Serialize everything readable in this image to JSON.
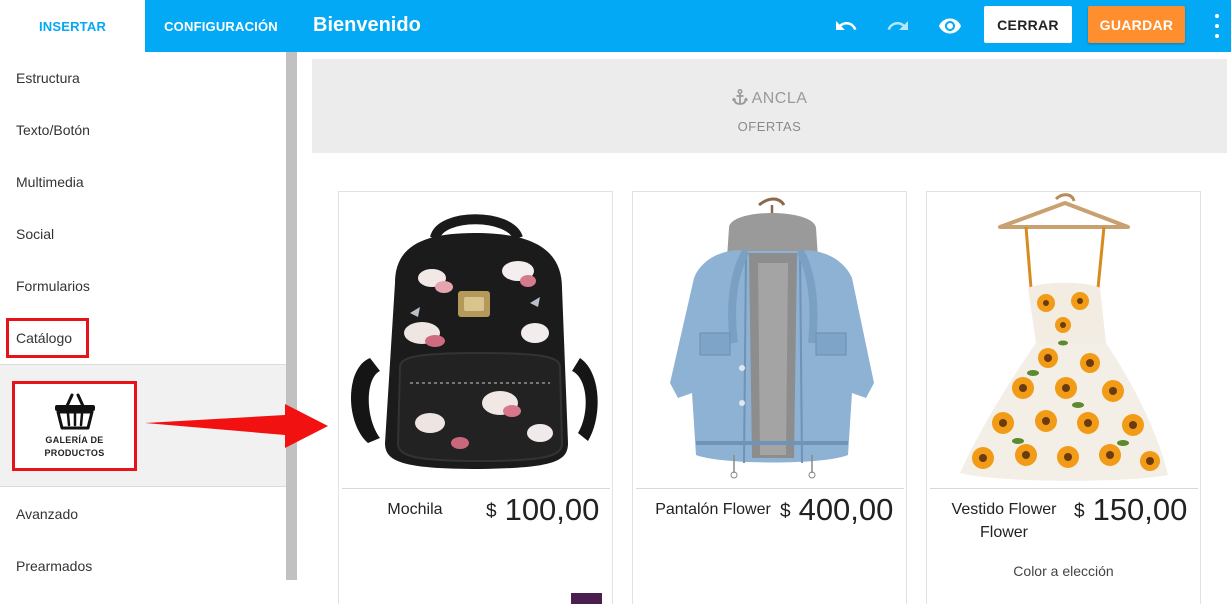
{
  "sidebar": {
    "tabs": [
      {
        "label": "INSERTAR"
      },
      {
        "label": "CONFIGURACIÓN"
      }
    ],
    "items": [
      {
        "label": "Estructura"
      },
      {
        "label": "Texto/Botón"
      },
      {
        "label": "Multimedia"
      },
      {
        "label": "Social"
      },
      {
        "label": "Formularios"
      },
      {
        "label": "Catálogo"
      },
      {
        "label": "Avanzado"
      },
      {
        "label": "Prearmados"
      }
    ],
    "tool": {
      "label": "GALERÍA DE PRODUCTOS",
      "icon": "shopping-basket-icon"
    }
  },
  "header": {
    "title": "Bienvenido",
    "icons": [
      "undo-icon",
      "redo-icon",
      "eye-icon",
      "more-vertical-icon"
    ],
    "close_label": "CERRAR",
    "save_label": "GUARDAR"
  },
  "anchor": {
    "title": "ANCLA",
    "subtitle": "OFERTAS",
    "icon": "anchor-icon"
  },
  "products": [
    {
      "name": "Mochila",
      "currency": "$",
      "price": "100,00"
    },
    {
      "name": "Pantalón Flower",
      "currency": "$",
      "price": "400,00"
    },
    {
      "name": "Vestido Flower Flower",
      "currency": "$",
      "price": "150,00",
      "option": "Color a elección"
    }
  ],
  "colors": {
    "primary": "#03a9f4",
    "accent": "#ff8f2e",
    "highlight": "#e8121b"
  }
}
